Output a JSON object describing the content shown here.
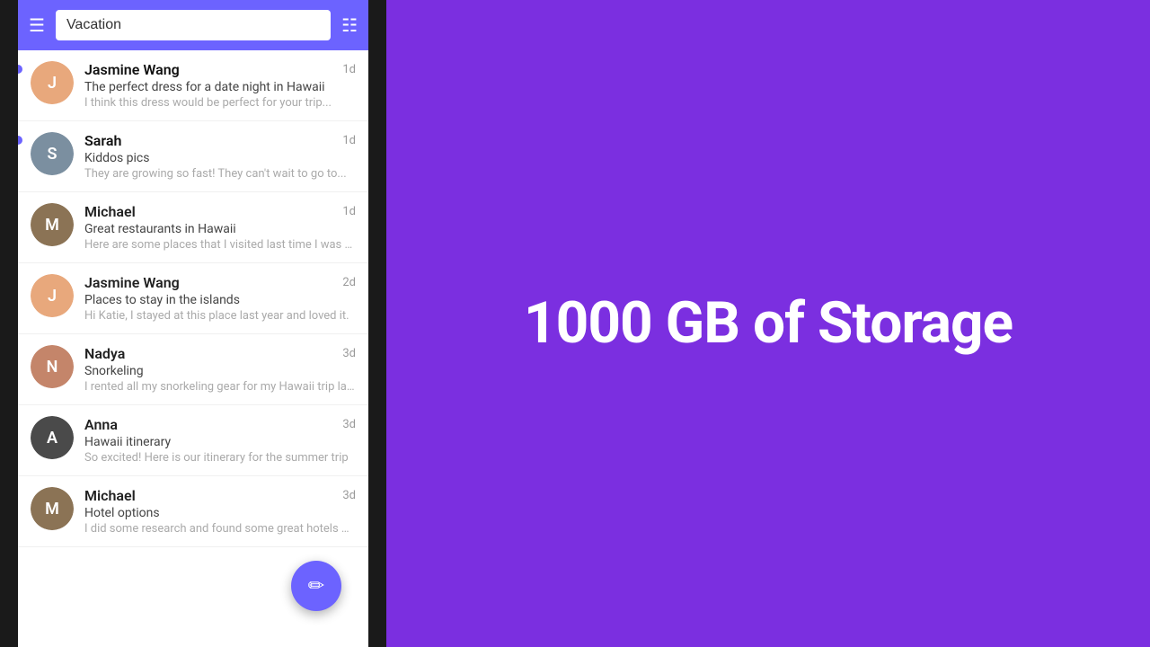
{
  "phone": {
    "search": {
      "placeholder": "Vacation",
      "value": "Vacation"
    }
  },
  "messages": [
    {
      "id": 1,
      "sender": "Jasmine Wang",
      "subject": "The perfect dress for a date night in Hawaii",
      "preview": "I think this dress would be perfect for your trip...",
      "time": "1d",
      "unread": true,
      "avatarColor": "#E8A87C",
      "avatarInitial": "J"
    },
    {
      "id": 2,
      "sender": "Sarah",
      "subject": "Kiddos pics",
      "preview": "They are growing so fast! They can't wait to go to...",
      "time": "1d",
      "unread": true,
      "avatarColor": "#7B8FA0",
      "avatarInitial": "S"
    },
    {
      "id": 3,
      "sender": "Michael",
      "subject": "Great restaurants in Hawaii",
      "preview": "Here are some places that I visited last time I was t...",
      "time": "1d",
      "unread": false,
      "avatarColor": "#8B7355",
      "avatarInitial": "M"
    },
    {
      "id": 4,
      "sender": "Jasmine Wang",
      "subject": "Places to stay in the islands",
      "preview": "Hi Katie, I stayed at this place last year and loved it.",
      "time": "2d",
      "unread": false,
      "avatarColor": "#E8A87C",
      "avatarInitial": "J"
    },
    {
      "id": 5,
      "sender": "Nadya",
      "subject": "Snorkeling",
      "preview": "I rented all my snorkeling gear for my Hawaii trip la...",
      "time": "3d",
      "unread": false,
      "avatarColor": "#C4856A",
      "avatarInitial": "N"
    },
    {
      "id": 6,
      "sender": "Anna",
      "subject": "Hawaii itinerary",
      "preview": "So excited! Here is our itinerary for the summer trip",
      "time": "3d",
      "unread": false,
      "avatarColor": "#4A4A4A",
      "avatarInitial": "A"
    },
    {
      "id": 7,
      "sender": "Michael",
      "subject": "Hotel options",
      "preview": "I did some research and found some great hotels o...",
      "time": "3d",
      "unread": false,
      "avatarColor": "#8B7355",
      "avatarInitial": "M"
    }
  ],
  "storage": {
    "headline": "1000 GB of Storage"
  },
  "fab": {
    "icon": "✏"
  }
}
